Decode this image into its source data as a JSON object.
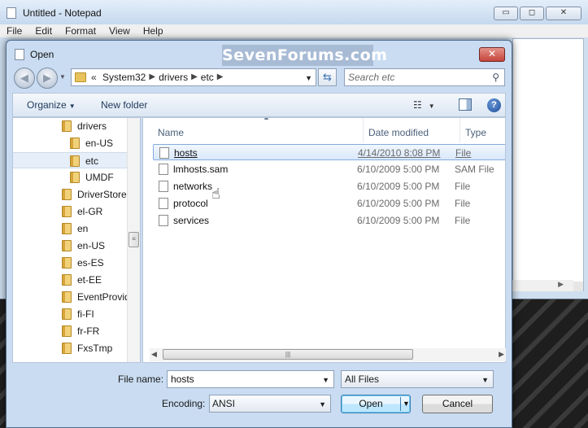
{
  "notepad": {
    "title": "Untitled - Notepad",
    "menu": [
      "File",
      "Edit",
      "Format",
      "View",
      "Help"
    ],
    "controls": {
      "minimize": "▭",
      "maximize": "◻",
      "close": "✕"
    }
  },
  "dialog": {
    "title": "Open",
    "watermark": "SevenForums.com",
    "close_label": "✕"
  },
  "nav": {
    "back": "◀",
    "forward": "▶",
    "address_overflow": "«",
    "breadcrumbs": [
      "System32",
      "drivers",
      "etc"
    ],
    "search_placeholder": "Search etc"
  },
  "toolbar": {
    "organize_label": "Organize",
    "new_folder_label": "New folder"
  },
  "tree": {
    "items": [
      {
        "label": "drivers",
        "indent": 1,
        "selected": false
      },
      {
        "label": "en-US",
        "indent": 2,
        "selected": false
      },
      {
        "label": "etc",
        "indent": 2,
        "selected": true
      },
      {
        "label": "UMDF",
        "indent": 2,
        "selected": false
      },
      {
        "label": "DriverStore",
        "indent": 1,
        "selected": false
      },
      {
        "label": "el-GR",
        "indent": 1,
        "selected": false
      },
      {
        "label": "en",
        "indent": 1,
        "selected": false
      },
      {
        "label": "en-US",
        "indent": 1,
        "selected": false
      },
      {
        "label": "es-ES",
        "indent": 1,
        "selected": false
      },
      {
        "label": "et-EE",
        "indent": 1,
        "selected": false
      },
      {
        "label": "EventProvid",
        "indent": 1,
        "selected": false
      },
      {
        "label": "fi-FI",
        "indent": 1,
        "selected": false
      },
      {
        "label": "fr-FR",
        "indent": 1,
        "selected": false
      },
      {
        "label": "FxsTmp",
        "indent": 1,
        "selected": false
      }
    ]
  },
  "files": {
    "columns": [
      "Name",
      "Date modified",
      "Type"
    ],
    "rows": [
      {
        "name": "hosts",
        "date": "4/14/2010 8:08 PM",
        "type": "File",
        "selected": true
      },
      {
        "name": "lmhosts.sam",
        "date": "6/10/2009 5:00 PM",
        "type": "SAM File",
        "selected": false
      },
      {
        "name": "networks",
        "date": "6/10/2009 5:00 PM",
        "type": "File",
        "selected": false
      },
      {
        "name": "protocol",
        "date": "6/10/2009 5:00 PM",
        "type": "File",
        "selected": false
      },
      {
        "name": "services",
        "date": "6/10/2009 5:00 PM",
        "type": "File",
        "selected": false
      }
    ]
  },
  "bottom": {
    "filename_label": "File name:",
    "filename_value": "hosts",
    "filter_value": "All Files",
    "encoding_label": "Encoding:",
    "encoding_value": "ANSI",
    "open_label": "Open",
    "cancel_label": "Cancel"
  }
}
